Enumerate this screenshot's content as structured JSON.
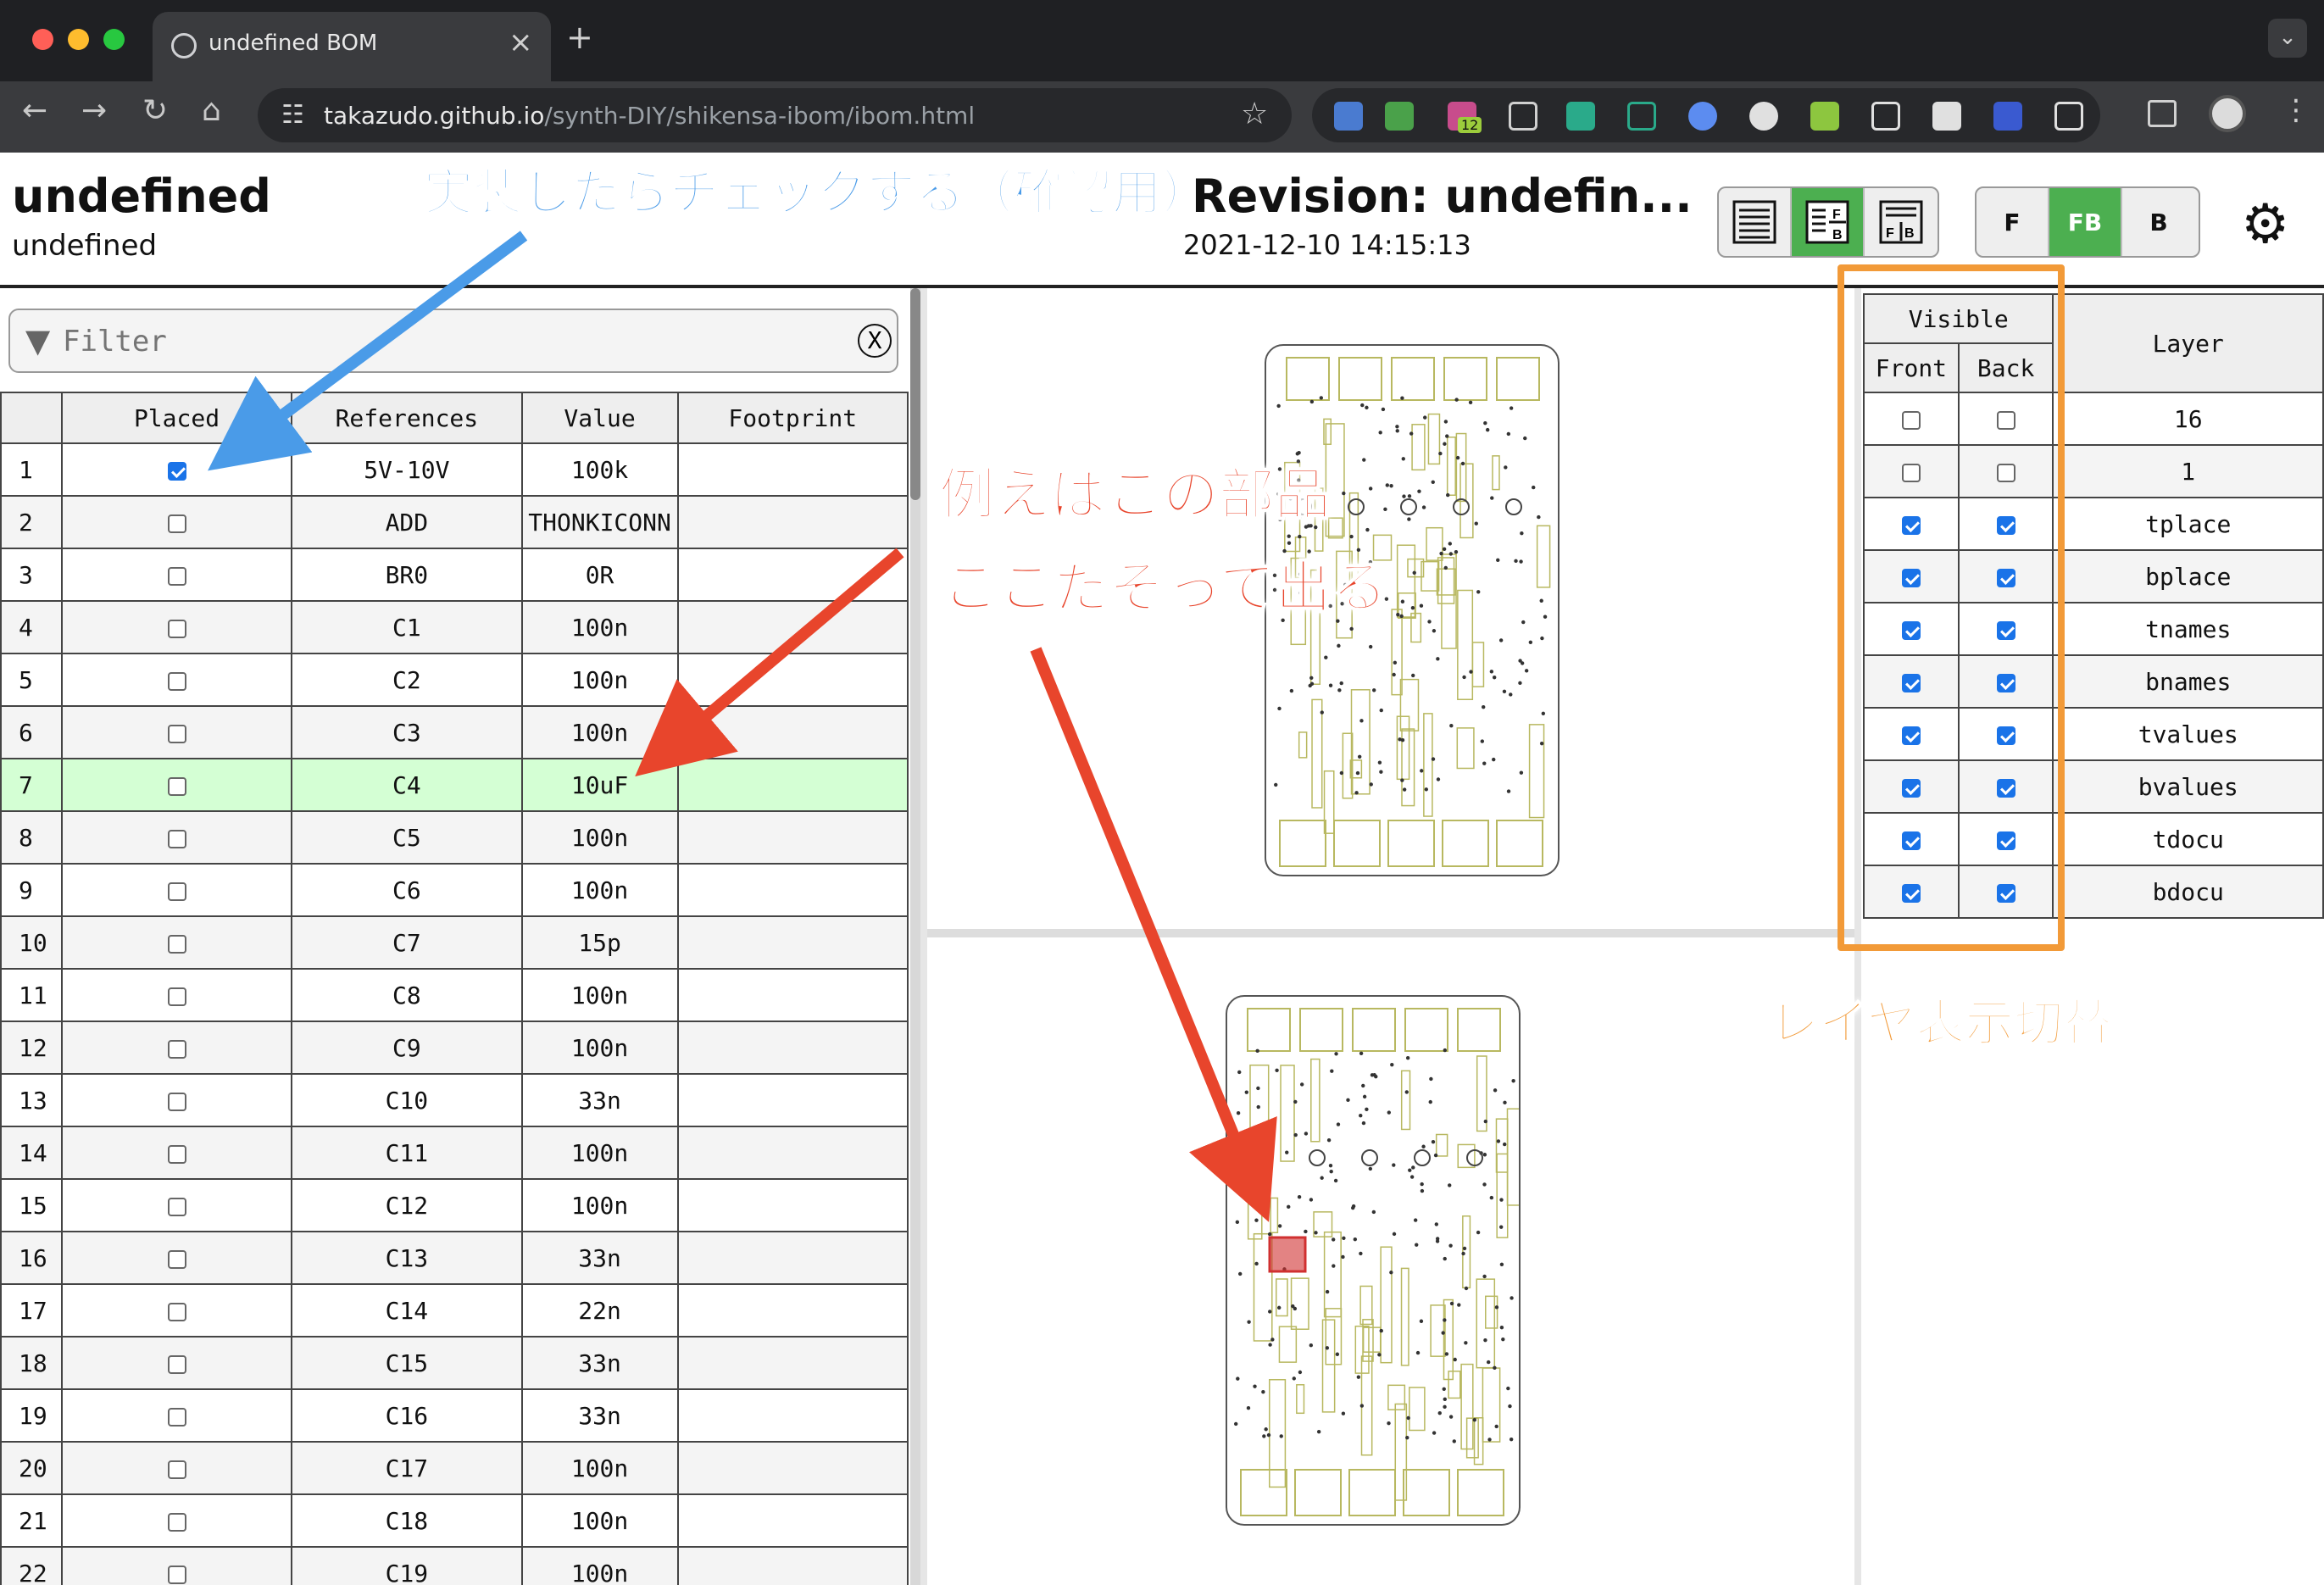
{
  "browser": {
    "tab_title": "undefined BOM",
    "url_domain": "takazudo.github.io",
    "url_path": "/synth-DIY/shikensa-ibom/ibom.html",
    "extension_badge": "12"
  },
  "header": {
    "title": "undefined",
    "subtitle": "undefined",
    "revision": "Revision: undefin...",
    "date": "2021-12-10 14:15:13",
    "layer_buttons": [
      "F",
      "FB",
      "B"
    ],
    "active_layer": "FB"
  },
  "filter": {
    "placeholder": "Filter",
    "clear_label": "X"
  },
  "bom": {
    "columns": [
      "",
      "Placed",
      "References",
      "Value",
      "Footprint"
    ],
    "highlight_row": 7,
    "rows": [
      {
        "num": "1",
        "placed": true,
        "ref": "5V-10V",
        "value": "100k"
      },
      {
        "num": "2",
        "placed": false,
        "ref": "ADD",
        "value": "THONKICONN"
      },
      {
        "num": "3",
        "placed": false,
        "ref": "BR0",
        "value": "0R"
      },
      {
        "num": "4",
        "placed": false,
        "ref": "C1",
        "value": "100n"
      },
      {
        "num": "5",
        "placed": false,
        "ref": "C2",
        "value": "100n"
      },
      {
        "num": "6",
        "placed": false,
        "ref": "C3",
        "value": "100n"
      },
      {
        "num": "7",
        "placed": false,
        "ref": "C4",
        "value": "10uF"
      },
      {
        "num": "8",
        "placed": false,
        "ref": "C5",
        "value": "100n"
      },
      {
        "num": "9",
        "placed": false,
        "ref": "C6",
        "value": "100n"
      },
      {
        "num": "10",
        "placed": false,
        "ref": "C7",
        "value": "15p"
      },
      {
        "num": "11",
        "placed": false,
        "ref": "C8",
        "value": "100n"
      },
      {
        "num": "12",
        "placed": false,
        "ref": "C9",
        "value": "100n"
      },
      {
        "num": "13",
        "placed": false,
        "ref": "C10",
        "value": "33n"
      },
      {
        "num": "14",
        "placed": false,
        "ref": "C11",
        "value": "100n"
      },
      {
        "num": "15",
        "placed": false,
        "ref": "C12",
        "value": "100n"
      },
      {
        "num": "16",
        "placed": false,
        "ref": "C13",
        "value": "33n"
      },
      {
        "num": "17",
        "placed": false,
        "ref": "C14",
        "value": "22n"
      },
      {
        "num": "18",
        "placed": false,
        "ref": "C15",
        "value": "33n"
      },
      {
        "num": "19",
        "placed": false,
        "ref": "C16",
        "value": "33n"
      },
      {
        "num": "20",
        "placed": false,
        "ref": "C17",
        "value": "100n"
      },
      {
        "num": "21",
        "placed": false,
        "ref": "C18",
        "value": "100n"
      },
      {
        "num": "22",
        "placed": false,
        "ref": "C19",
        "value": "100n"
      }
    ]
  },
  "layers": {
    "header_visible": "Visible",
    "header_front": "Front",
    "header_back": "Back",
    "header_layer": "Layer",
    "rows": [
      {
        "name": "16",
        "front": false,
        "back": false
      },
      {
        "name": "1",
        "front": false,
        "back": false
      },
      {
        "name": "tplace",
        "front": true,
        "back": true
      },
      {
        "name": "bplace",
        "front": true,
        "back": true
      },
      {
        "name": "tnames",
        "front": true,
        "back": true
      },
      {
        "name": "bnames",
        "front": true,
        "back": true
      },
      {
        "name": "tvalues",
        "front": true,
        "back": true
      },
      {
        "name": "bvalues",
        "front": true,
        "back": true
      },
      {
        "name": "tdocu",
        "front": true,
        "back": true
      },
      {
        "name": "bdocu",
        "front": true,
        "back": true
      }
    ]
  },
  "annotations": {
    "top": "実装したらチェックする（確認用）",
    "middle_line1": "例えばこの部品",
    "middle_line2": "ここだぞって出る",
    "layer": "レイヤ表示切替"
  },
  "colors": {
    "accent_green": "#4caf50",
    "highlight_row": "#d4ffd4",
    "annotation_blue": "#4a9be8",
    "annotation_red": "#e8452c",
    "annotation_orange": "#f29a38",
    "pcb_silk": "#b8b860",
    "highlight_part": "#d03030"
  }
}
